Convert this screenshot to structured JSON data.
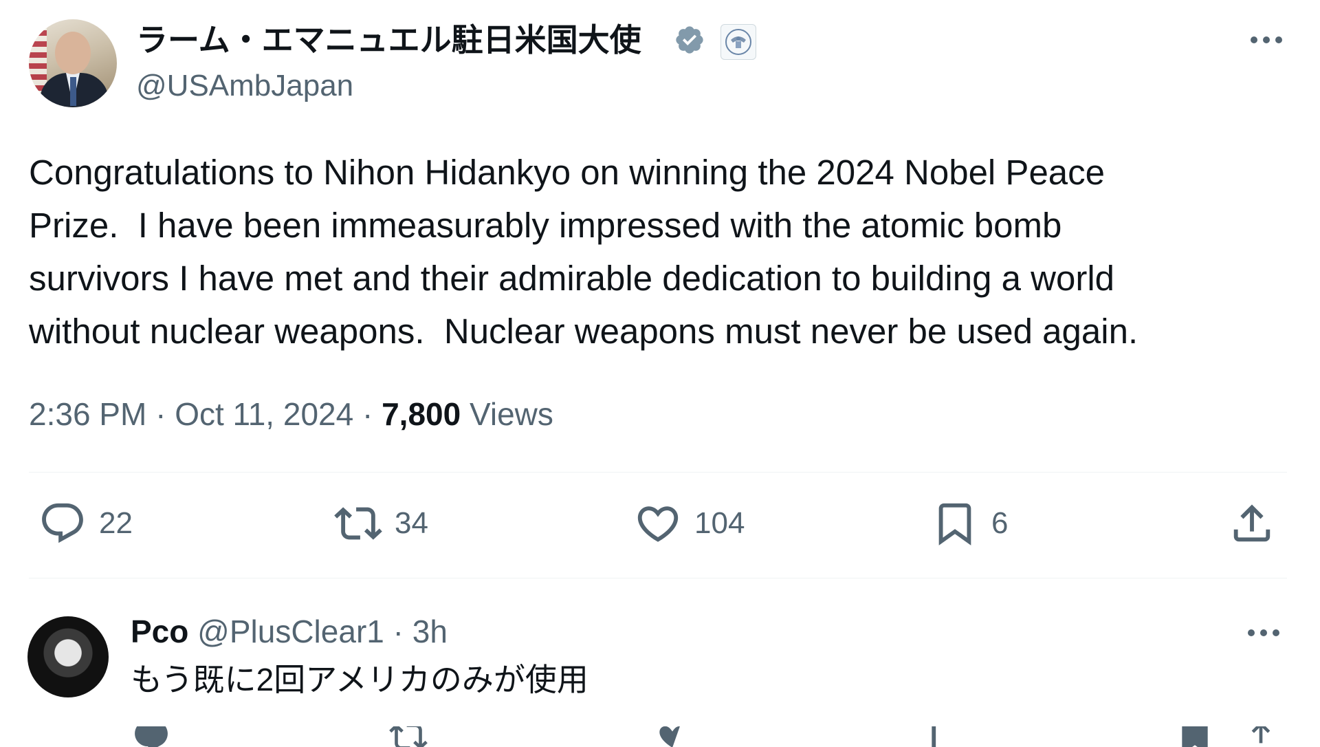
{
  "tweet": {
    "author_name": "ラーム・エマニュエル駐日米国大使",
    "handle": "@USAmbJapan",
    "text": "Congratulations to Nihon Hidankyo on winning the 2024 Nobel Peace\nPrize.  I have been immeasurably impressed with the atomic bomb\nsurvivors I have met and their admirable dedication to building a world\nwithout nuclear weapons.  Nuclear weapons must never be used again.",
    "time": "2:36 PM",
    "date": "Oct 11, 2024",
    "separator": "·",
    "views_count": "7,800",
    "views_label": "Views",
    "replies": "22",
    "retweets": "34",
    "likes": "104",
    "bookmarks": "6",
    "icons": [
      "verified-badge-icon",
      "gov-seal-icon",
      "more-icon",
      "reply-icon",
      "retweet-icon",
      "like-icon",
      "bookmark-icon",
      "share-icon"
    ]
  },
  "reply": {
    "author_name": "Pco",
    "handle": "@PlusClear1",
    "time": "3h",
    "text": "もう既に2回アメリカのみが使用"
  },
  "colors": {
    "text": "#0f1419",
    "secondary": "#536471",
    "verified": "#829aab",
    "divider": "#eff3f4"
  }
}
